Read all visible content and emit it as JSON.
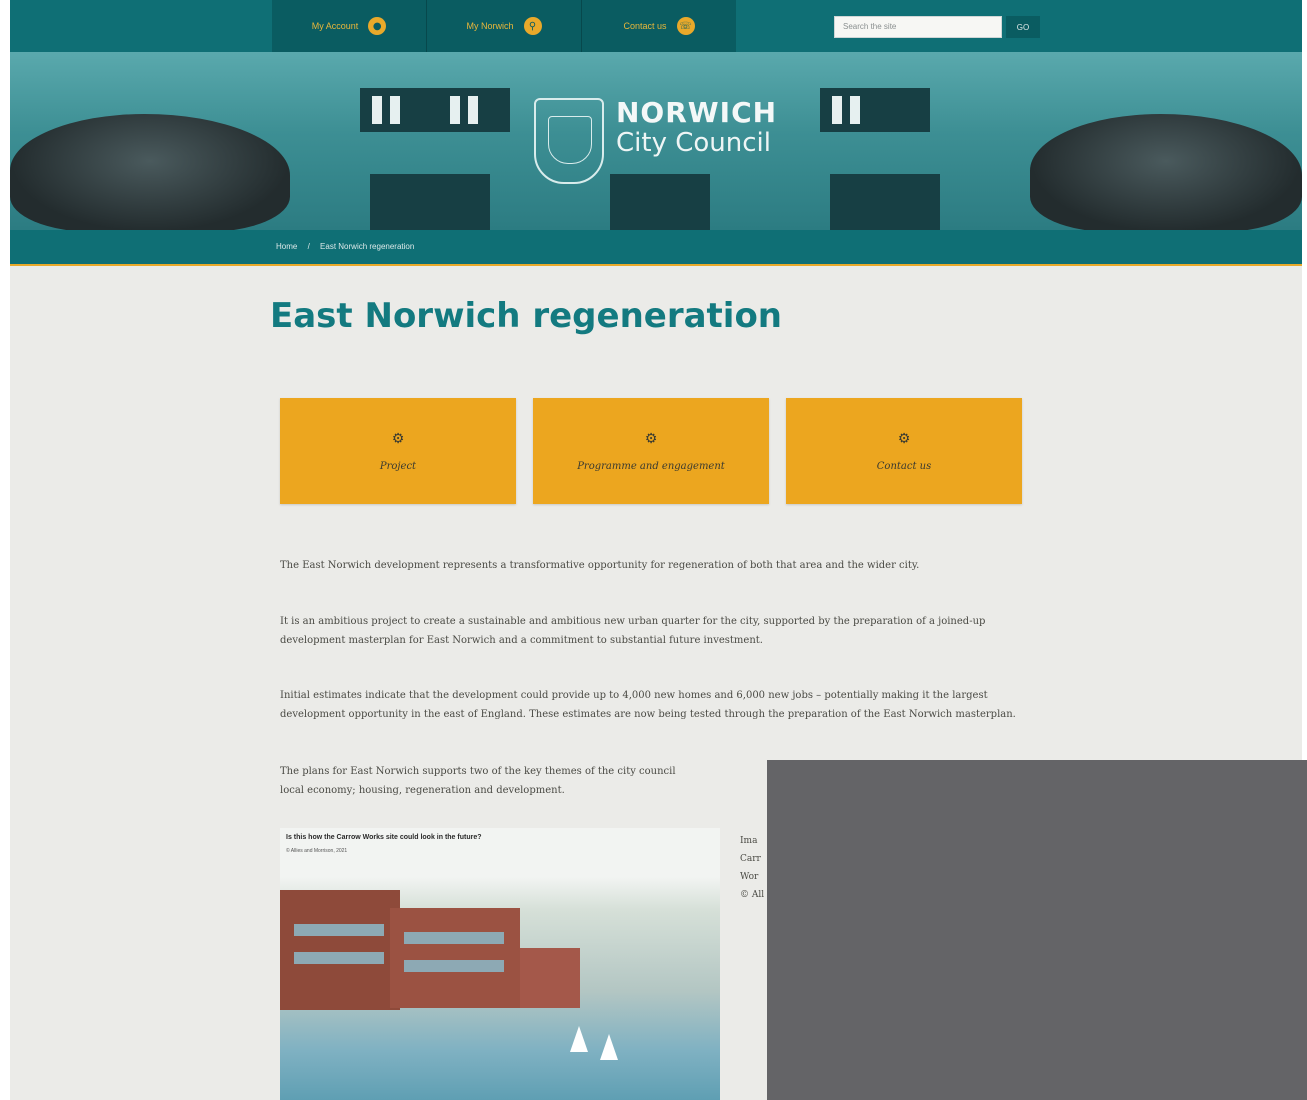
{
  "nav": {
    "items": [
      {
        "label": "My Account",
        "icon": "person-icon"
      },
      {
        "label": "My Norwich",
        "icon": "location-pin-icon"
      },
      {
        "label": "Contact us",
        "icon": "phone-icon"
      }
    ],
    "search_placeholder": "Search the site",
    "search_button": "GO"
  },
  "brand": {
    "line1": "NORWICH",
    "line2": "City Council"
  },
  "breadcrumb": {
    "home": "Home",
    "separator": "/",
    "current": "East Norwich regeneration"
  },
  "page_title": "East Norwich regeneration",
  "cards": [
    {
      "label": "Project",
      "icon": "gear-icon"
    },
    {
      "label": "Programme and engagement",
      "icon": "gear-icon"
    },
    {
      "label": "Contact us",
      "icon": "gear-icon"
    }
  ],
  "paragraphs": [
    "The East Norwich development represents a transformative opportunity for regeneration of both that area and the wider city.",
    "It is an ambitious project to create a sustainable and ambitious new urban quarter for the city, supported by the preparation of a joined-up development masterplan for East Norwich and a commitment to substantial future investment.",
    "Initial estimates indicate that the development could provide up to 4,000 new homes and 6,000 new jobs – potentially making it the largest development opportunity in the east of England. These estimates are now being tested through the preparation of the East Norwich masterplan.",
    "The plans for East Norwich supports two of the key themes of the city council"
  ],
  "paragraph4_line2": "local economy; housing, regeneration and development.",
  "figure": {
    "title": "Is this how the Carrow Works site could look in the future?",
    "credit": "© Allies and Morrison, 2021"
  },
  "caption_lines": [
    "Ima",
    "Carr",
    "Wor",
    "© All"
  ],
  "colors": {
    "teal": "#0f6f75",
    "teal_dark": "#0a5c61",
    "gold": "#eca61f",
    "title_teal": "#137a80",
    "overlay_gray": "#646467"
  }
}
